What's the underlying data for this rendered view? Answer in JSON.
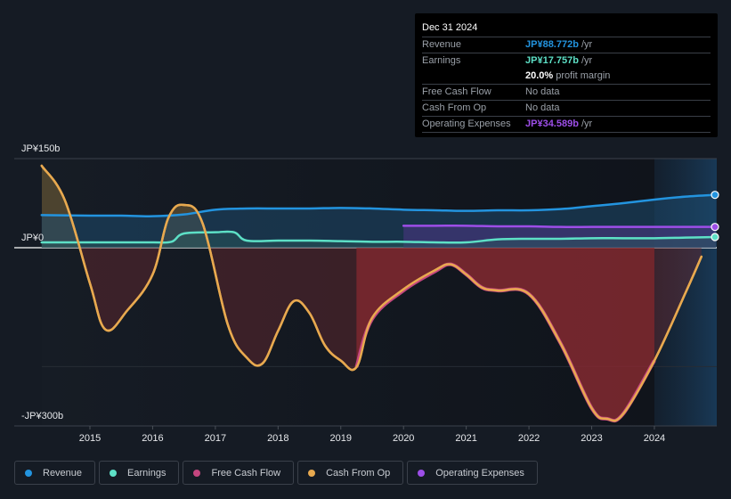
{
  "tooltip": {
    "date": "Dec 31 2024",
    "rows": [
      {
        "label": "Revenue",
        "value": "JP¥88.772b",
        "suffix": " /yr",
        "color": "#2394df"
      },
      {
        "label": "Earnings",
        "value": "JP¥17.757b",
        "suffix": " /yr",
        "color": "#5de0c6"
      },
      {
        "label": "",
        "value": "20.0%",
        "suffix": " profit margin",
        "color": "#ffffff"
      },
      {
        "label": "Free Cash Flow",
        "value": "",
        "suffix": "No data",
        "color": "#9aa0a8"
      },
      {
        "label": "Cash From Op",
        "value": "",
        "suffix": "No data",
        "color": "#9aa0a8"
      },
      {
        "label": "Operating Expenses",
        "value": "JP¥34.589b",
        "suffix": " /yr",
        "color": "#9d4ee8"
      }
    ]
  },
  "legend": [
    {
      "label": "Revenue",
      "color": "#2394df"
    },
    {
      "label": "Earnings",
      "color": "#5de0c6"
    },
    {
      "label": "Free Cash Flow",
      "color": "#c4467f"
    },
    {
      "label": "Cash From Op",
      "color": "#e8a94f"
    },
    {
      "label": "Operating Expenses",
      "color": "#9d4ee8"
    }
  ],
  "chart_data": {
    "type": "area",
    "title": "",
    "xlabel": "",
    "ylabel": "",
    "unit": "JP¥ billions",
    "x_ticks": [
      "2015",
      "2016",
      "2017",
      "2018",
      "2019",
      "2020",
      "2021",
      "2022",
      "2023",
      "2024"
    ],
    "y_tick_labels": [
      {
        "value": 150,
        "label": "JP¥150b"
      },
      {
        "value": 0,
        "label": "JP¥0"
      },
      {
        "value": -300,
        "label": "-JP¥300b"
      }
    ],
    "xlim": [
      2014.0,
      2025.0
    ],
    "ylim": [
      -300,
      150
    ],
    "gridlines_at": [
      150,
      0,
      -200,
      -300
    ],
    "forecast_region_start": 2024.0,
    "series": [
      {
        "name": "Revenue",
        "color": "#2394df",
        "x": [
          2014.23,
          2015.0,
          2015.5,
          2016.0,
          2016.5,
          2017.0,
          2017.5,
          2018.0,
          2018.5,
          2019.0,
          2019.5,
          2020.0,
          2020.5,
          2021.0,
          2021.5,
          2022.0,
          2022.5,
          2023.0,
          2023.5,
          2024.0,
          2024.5,
          2024.98
        ],
        "y": [
          55,
          54,
          54,
          53,
          56,
          64,
          66,
          66,
          66,
          67,
          66,
          64,
          63,
          62,
          63,
          63,
          65,
          70,
          75,
          81,
          86,
          89
        ]
      },
      {
        "name": "Earnings",
        "color": "#5de0c6",
        "x": [
          2014.23,
          2015.0,
          2015.5,
          2016.0,
          2016.3,
          2016.5,
          2017.0,
          2017.3,
          2017.5,
          2018.0,
          2018.5,
          2019.0,
          2019.5,
          2020.0,
          2020.5,
          2021.0,
          2021.5,
          2022.0,
          2022.5,
          2023.0,
          2023.5,
          2024.0,
          2024.5,
          2024.98
        ],
        "y": [
          9,
          9,
          9,
          9,
          10,
          24,
          26,
          26,
          12,
          12,
          12,
          11,
          10,
          10,
          9,
          9,
          14,
          15,
          15,
          16,
          16,
          16,
          17,
          18
        ]
      },
      {
        "name": "Free Cash Flow",
        "color": "#c4467f",
        "x": [
          2019.25,
          2019.5,
          2020.0,
          2020.5,
          2020.75,
          2021.0,
          2021.25,
          2021.5,
          2022.0,
          2022.5,
          2023.0,
          2023.25,
          2023.5,
          2024.0
        ],
        "y": [
          -201,
          -120,
          -72,
          -40,
          -28,
          -45,
          -67,
          -72,
          -78,
          -160,
          -270,
          -288,
          -280,
          -190
        ]
      },
      {
        "name": "Cash From Op",
        "color": "#e8a94f",
        "x": [
          2014.23,
          2014.6,
          2015.0,
          2015.25,
          2015.6,
          2016.0,
          2016.25,
          2016.5,
          2016.8,
          2017.2,
          2017.5,
          2017.75,
          2018.0,
          2018.25,
          2018.5,
          2018.75,
          2019.0,
          2019.25,
          2019.5,
          2020.0,
          2020.5,
          2020.75,
          2021.0,
          2021.25,
          2021.5,
          2022.0,
          2022.5,
          2023.0,
          2023.25,
          2023.5,
          2024.0,
          2024.5,
          2024.75
        ],
        "y": [
          138,
          80,
          -60,
          -138,
          -105,
          -45,
          50,
          72,
          40,
          -130,
          -185,
          -195,
          -140,
          -90,
          -110,
          -165,
          -190,
          -201,
          -118,
          -70,
          -38,
          -28,
          -45,
          -67,
          -72,
          -78,
          -160,
          -270,
          -288,
          -280,
          -190,
          -75,
          -15
        ]
      },
      {
        "name": "Operating Expenses",
        "color": "#9d4ee8",
        "x": [
          2020.0,
          2020.5,
          2021.0,
          2021.5,
          2022.0,
          2022.5,
          2023.0,
          2023.5,
          2024.0,
          2024.5,
          2024.98
        ],
        "y": [
          37,
          37,
          37,
          36,
          36,
          35,
          35,
          35,
          35,
          35,
          35
        ]
      }
    ]
  }
}
